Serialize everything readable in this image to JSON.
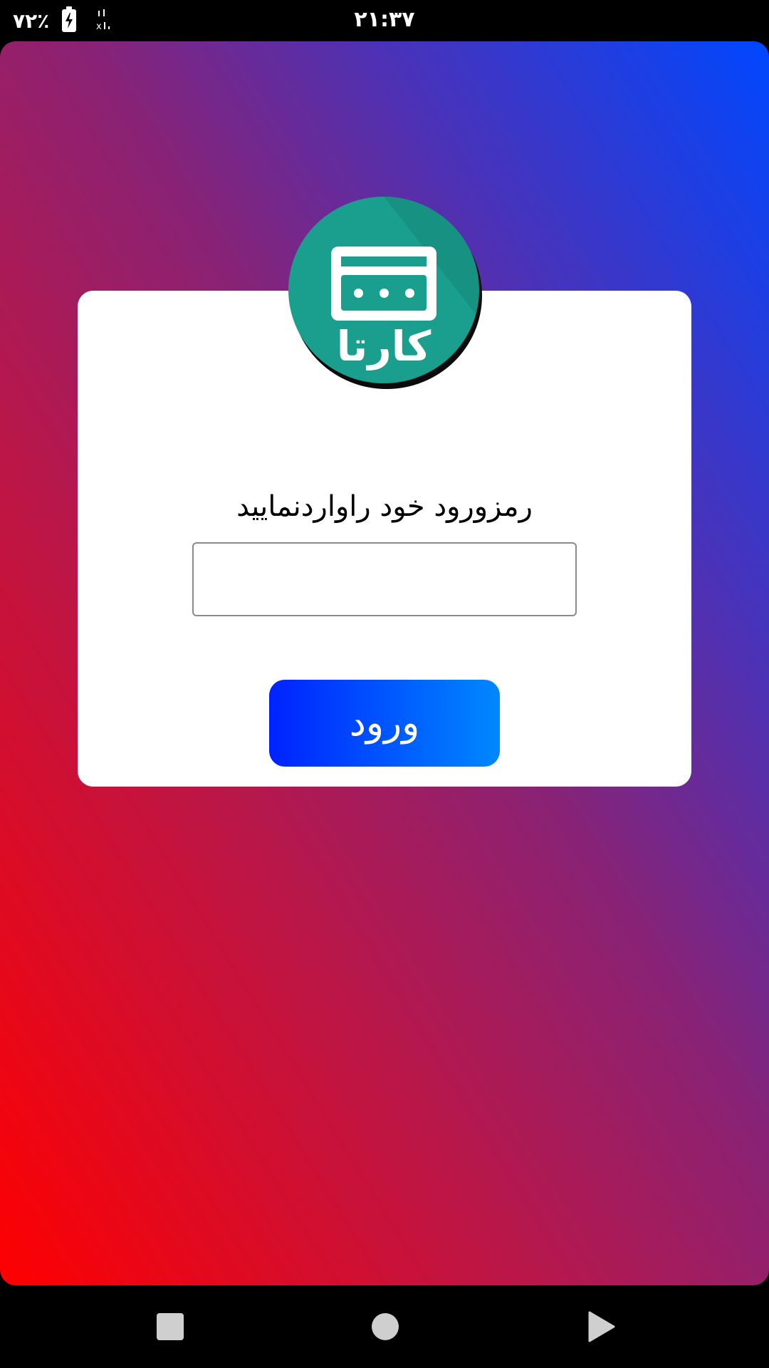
{
  "status_bar": {
    "battery_percent": "۷۲٪",
    "time": "۲۱:۳۷",
    "icons": [
      "battery-charging-icon",
      "signal-icon"
    ]
  },
  "logo": {
    "text": "کارتا",
    "icon": "credit-card-icon",
    "color": "#1a9f8e"
  },
  "login": {
    "prompt": "رمزورود خود راواردنمایید",
    "password_value": "",
    "password_placeholder": "",
    "button_label": "ورود"
  },
  "colors": {
    "gradient_start": "#ff0000",
    "gradient_end": "#0047ff",
    "button_start": "#0022ff",
    "button_end": "#0088ff"
  },
  "nav_bar": {
    "icons": [
      "recents-square-icon",
      "home-circle-icon",
      "back-triangle-icon"
    ]
  }
}
